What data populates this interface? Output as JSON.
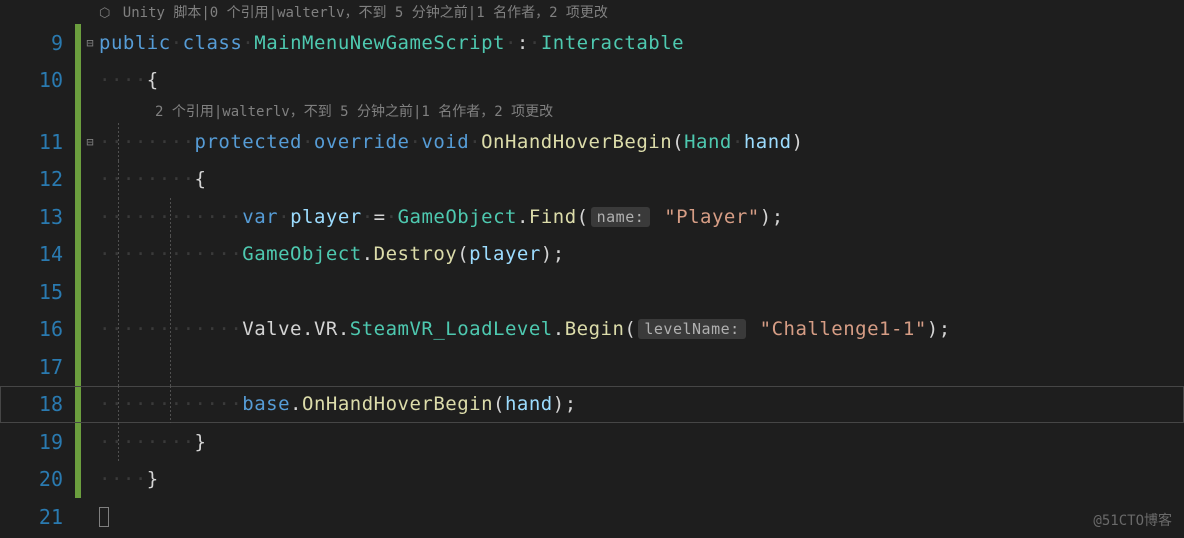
{
  "codelens1": {
    "icon": "⬡",
    "text": " Unity 脚本|0 个引用|walterlv，不到 5 分钟之前|1 名作者，2 项更改"
  },
  "codelens2": {
    "text": "2 个引用|walterlv，不到 5 分钟之前|1 名作者，2 项更改"
  },
  "lines": {
    "l9": "9",
    "l10": "10",
    "l11": "11",
    "l12": "12",
    "l13": "13",
    "l14": "14",
    "l15": "15",
    "l16": "16",
    "l17": "17",
    "l18": "18",
    "l19": "19",
    "l20": "20",
    "l21": "21"
  },
  "fold": {
    "minus": "⊟"
  },
  "tokens": {
    "public": "public",
    "class": "class",
    "className": "MainMenuNewGameScript",
    "colon": ":",
    "baseType": "Interactable",
    "lbrace": "{",
    "rbrace": "}",
    "protected": "protected",
    "override": "override",
    "void": "void",
    "methodName": "OnHandHoverBegin",
    "Hand": "Hand",
    "hand": "hand",
    "var": "var",
    "player": "player",
    "eq": "=",
    "GameObject": "GameObject",
    "Find": "Find",
    "nameHint": "name:",
    "playerStr": "\"Player\"",
    "Destroy": "Destroy",
    "Valve": "Valve",
    "VR": "VR",
    "SteamVR": "SteamVR_LoadLevel",
    "Begin": "Begin",
    "levelNameHint": "levelName:",
    "challengeStr": "\"Challenge1-1\"",
    "base": "base",
    "lparen": "(",
    "rparen": ")",
    "semi": ";",
    "dot": "."
  },
  "dots4": "····",
  "dots8": "········",
  "dots12": "············",
  "watermark": "@51CTO博客"
}
